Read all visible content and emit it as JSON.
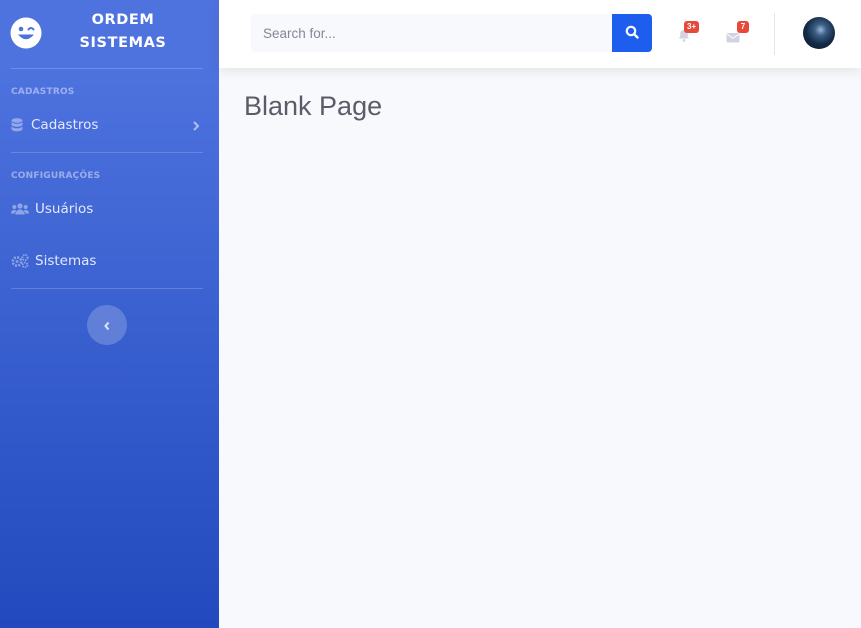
{
  "brand": {
    "name": "ORDEM SISTEMAS",
    "line1": "ORDEM",
    "line2": "SISTEMAS",
    "icon": "laugh-wink-icon"
  },
  "sidebar": {
    "headings": [
      "CADASTROS",
      "CONFIGURAÇÕES"
    ],
    "items": [
      {
        "label": "Cadastros",
        "icon": "database-icon",
        "has_children": true
      },
      {
        "label": "Usuários",
        "icon": "users-icon"
      },
      {
        "label": "Sistemas",
        "icon": "cogs-icon"
      }
    ],
    "toggle_icon": "chevron-left-icon"
  },
  "topbar": {
    "search": {
      "placeholder": "Search for...",
      "value": "",
      "button_icon": "search-icon"
    },
    "alerts": {
      "icon": "bell-icon",
      "badge": "3+"
    },
    "messages": {
      "icon": "envelope-icon",
      "badge": "7"
    },
    "user_avatar": "avatar"
  },
  "main": {
    "title": "Blank Page"
  },
  "colors": {
    "sidebar_start": "#4e73df",
    "sidebar_end": "#224abe",
    "search_button": "#1e5eef",
    "badge": "#e74a3b",
    "background": "#f8f9fc",
    "title_text": "#5a5c69"
  }
}
